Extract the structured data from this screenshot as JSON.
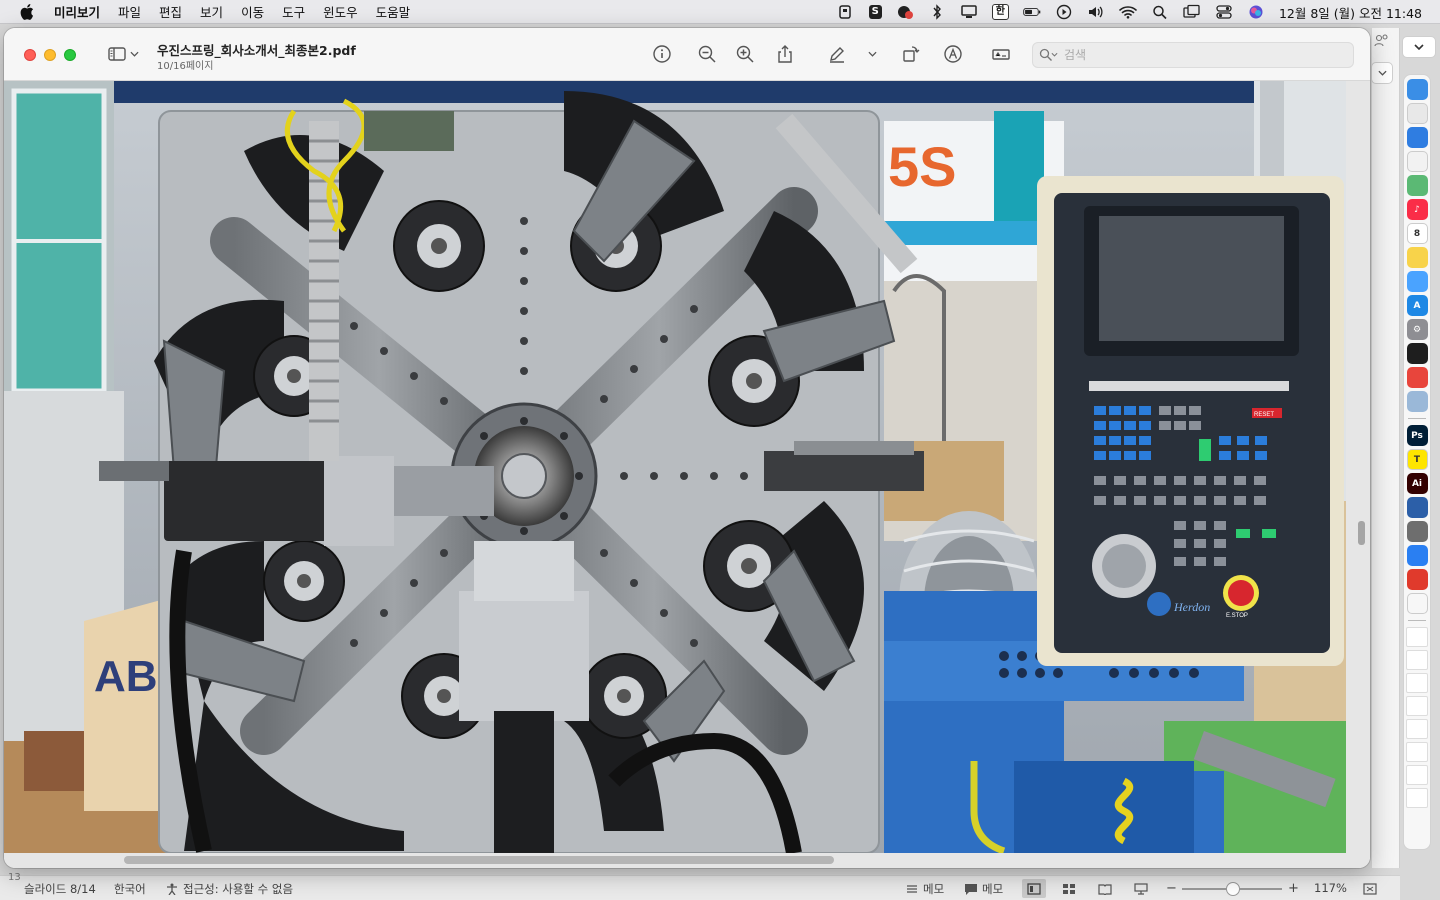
{
  "menubar": {
    "app_name": "미리보기",
    "items": [
      "파일",
      "편집",
      "보기",
      "이동",
      "도구",
      "윈도우",
      "도움말"
    ],
    "input_badge": "한",
    "clock": "12월 8일 (월) 오전 11:48"
  },
  "window": {
    "title": "우진스프링_회사소개서_최종본2.pdf",
    "subtitle": "10/16페이지",
    "search_placeholder": "검색"
  },
  "photo": {
    "sign_text": "5S",
    "panel_brand": "Herdon",
    "reset_label": "RESET",
    "stop_label": "E.STOP",
    "bag_text": "ABS"
  },
  "statusbar": {
    "slide": "슬라이드 8/14",
    "language": "한국어",
    "accessibility": "접근성: 사용할 수 없음",
    "notes": "메모",
    "comments": "메모",
    "zoom": "117%",
    "left_fragment": "13"
  },
  "dock": {
    "apps": [
      {
        "name": "finder-icon",
        "color": "#3a8ee6",
        "label": ""
      },
      {
        "name": "launchpad-icon",
        "color": "#e8e8e8",
        "label": ""
      },
      {
        "name": "mail-icon",
        "color": "#2f7de1",
        "label": ""
      },
      {
        "name": "reminders-icon",
        "color": "#f2f2f2",
        "label": ""
      },
      {
        "name": "maps-icon",
        "color": "#5bb974",
        "label": ""
      },
      {
        "name": "music-icon",
        "color": "#fa2d48",
        "label": "♪"
      },
      {
        "name": "calendar-icon",
        "color": "#ffffff",
        "label": "8"
      },
      {
        "name": "notes-icon",
        "color": "#f8d34a",
        "label": ""
      },
      {
        "name": "freeform-icon",
        "color": "#4aa3ff",
        "label": ""
      },
      {
        "name": "appstore-icon",
        "color": "#1e88e5",
        "label": "A"
      },
      {
        "name": "settings-icon",
        "color": "#8e8e93",
        "label": "⚙"
      },
      {
        "name": "figma-icon",
        "color": "#1e1e1e",
        "label": ""
      },
      {
        "name": "chrome-icon",
        "color": "#e8453c",
        "label": ""
      },
      {
        "name": "preview-icon",
        "color": "#9ab8d8",
        "label": ""
      },
      {
        "name": "photoshop-icon",
        "color": "#001e36",
        "label": "Ps"
      },
      {
        "name": "kakaotalk-icon",
        "color": "#fee500",
        "label": "T"
      },
      {
        "name": "illustrator-icon",
        "color": "#330000",
        "label": "Ai"
      },
      {
        "name": "proxyman-icon",
        "color": "#2c5fa8",
        "label": ""
      },
      {
        "name": "wechat-icon",
        "color": "#6e6e6e",
        "label": ""
      },
      {
        "name": "messenger-icon",
        "color": "#2a7ff2",
        "label": ""
      },
      {
        "name": "acrobat-icon",
        "color": "#e03a2c",
        "label": ""
      },
      {
        "name": "collab-icon",
        "color": "#f7f7f7",
        "label": ""
      }
    ]
  }
}
